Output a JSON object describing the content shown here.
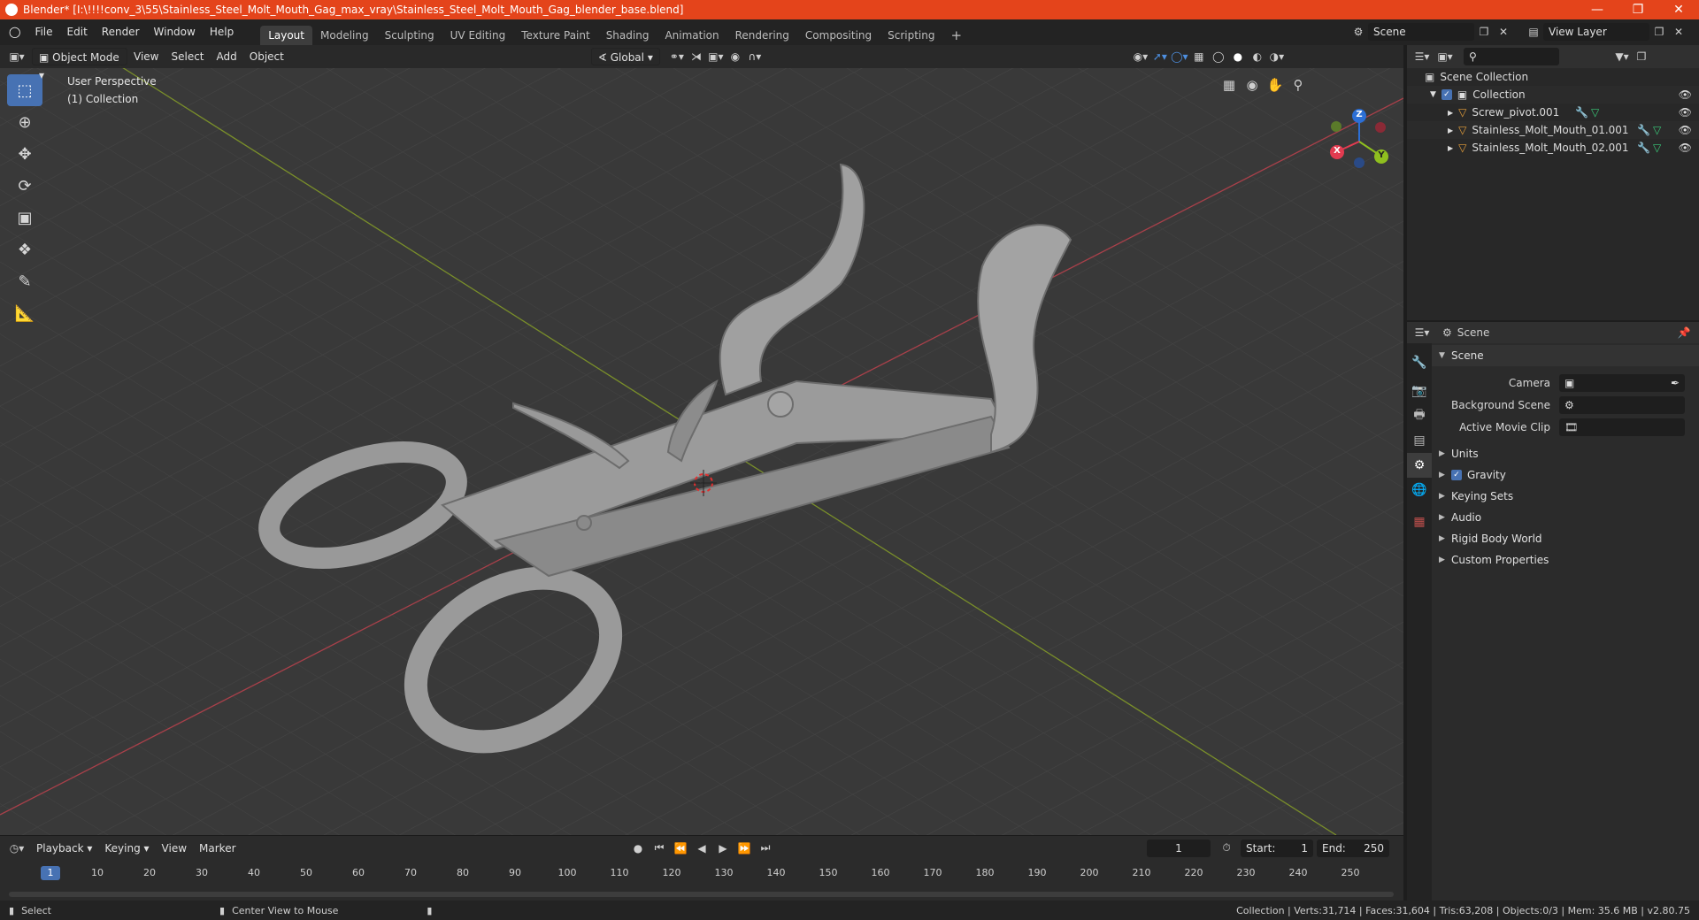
{
  "titlebar": {
    "title": "Blender* [I:\\!!!!conv_3\\55\\Stainless_Steel_Molt_Mouth_Gag_max_vray\\Stainless_Steel_Molt_Mouth_Gag_blender_base.blend]"
  },
  "menu": {
    "file": "File",
    "edit": "Edit",
    "render": "Render",
    "window": "Window",
    "help": "Help"
  },
  "workspaces": [
    "Layout",
    "Modeling",
    "Sculpting",
    "UV Editing",
    "Texture Paint",
    "Shading",
    "Animation",
    "Rendering",
    "Compositing",
    "Scripting"
  ],
  "scene_field": "Scene",
  "view_layer_field": "View Layer",
  "viewport_header": {
    "mode": "Object Mode",
    "view": "View",
    "select": "Select",
    "add": "Add",
    "object": "Object",
    "orientation": "Global"
  },
  "viewport": {
    "perspective": "User Perspective",
    "collection": "(1) Collection"
  },
  "gizmo": {
    "z": "Z",
    "y": "Y",
    "x": "X"
  },
  "outliner": {
    "root": "Scene Collection",
    "collection": "Collection",
    "objects": [
      "Screw_pivot.001",
      "Stainless_Molt_Mouth_01.001",
      "Stainless_Molt_Mouth_02.001"
    ]
  },
  "properties": {
    "header": "Scene",
    "section": "Scene",
    "camera_label": "Camera",
    "background_label": "Background Scene",
    "movieclip_label": "Active Movie Clip",
    "subsections": [
      "Units",
      "Gravity",
      "Keying Sets",
      "Audio",
      "Rigid Body World",
      "Custom Properties"
    ]
  },
  "timeline": {
    "playback": "Playback",
    "keying": "Keying",
    "view": "View",
    "marker": "Marker",
    "current_frame": "1",
    "start_label": "Start:",
    "start": "1",
    "end_label": "End:",
    "end": "250",
    "ticks": [
      "1",
      "10",
      "20",
      "30",
      "40",
      "50",
      "60",
      "70",
      "80",
      "90",
      "100",
      "110",
      "120",
      "130",
      "140",
      "150",
      "160",
      "170",
      "180",
      "190",
      "200",
      "210",
      "220",
      "230",
      "240",
      "250"
    ]
  },
  "statusbar": {
    "select": "Select",
    "center": "Center View to Mouse",
    "stats": "Collection | Verts:31,714 | Faces:31,604 | Tris:63,208 | Objects:0/3 | Mem: 35.6 MB | v2.80.75"
  }
}
